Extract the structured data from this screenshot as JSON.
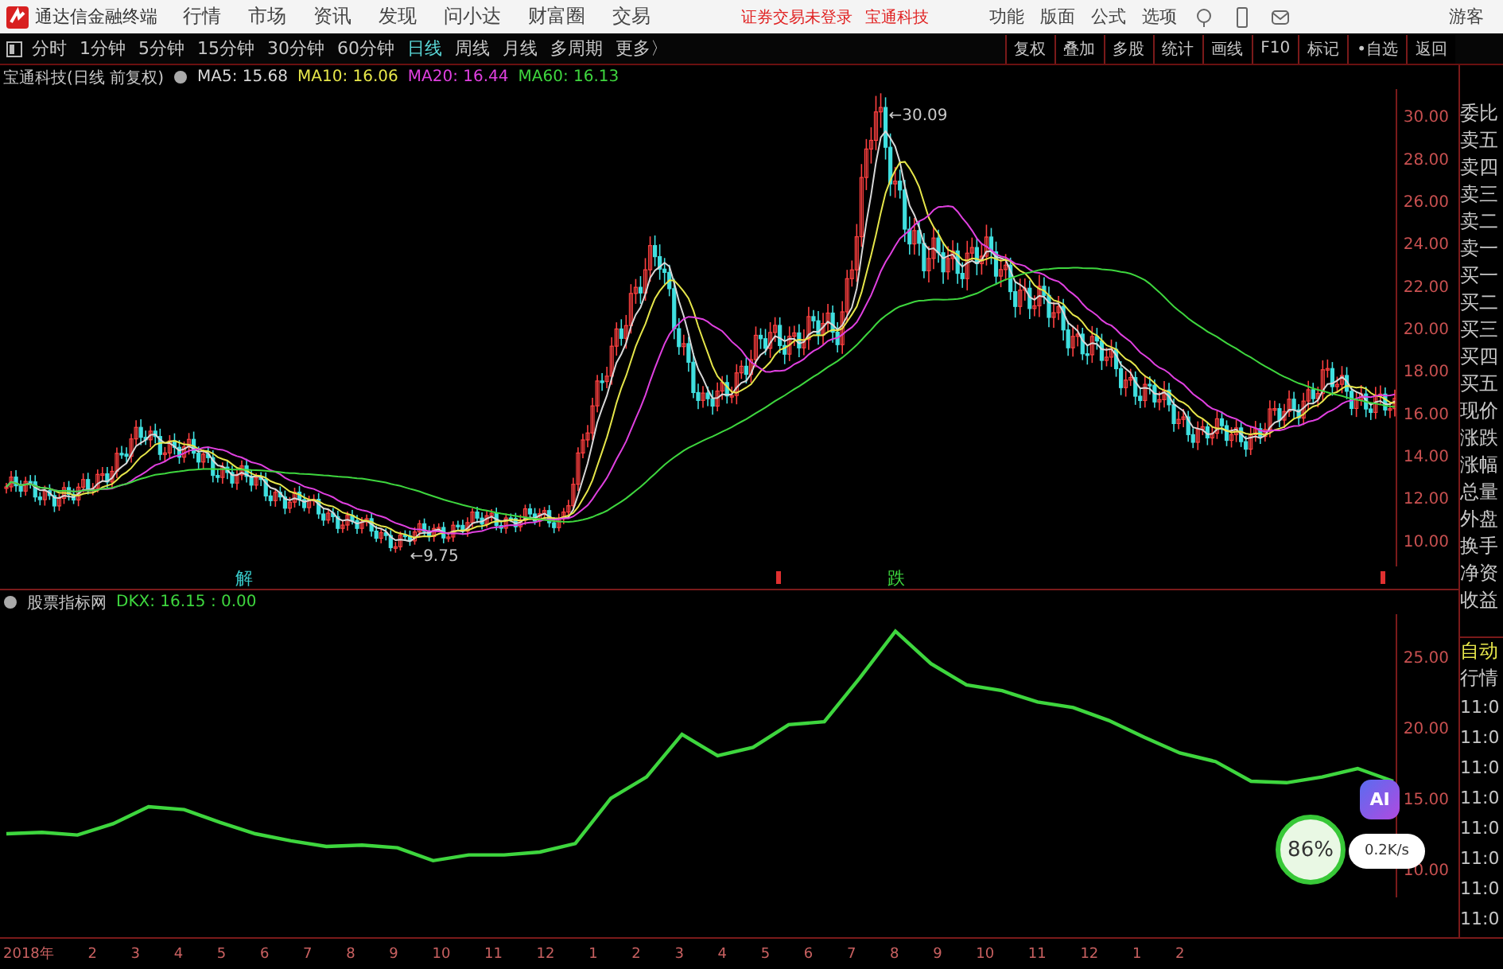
{
  "top_bar": {
    "app_title": "通达信金融终端",
    "menu": [
      "行情",
      "市场",
      "资讯",
      "发现",
      "问小达",
      "财富圈",
      "交易"
    ],
    "notices": [
      "证券交易未登录",
      "宝通科技"
    ],
    "right_menu": [
      "功能",
      "版面",
      "公式",
      "选项"
    ],
    "user": "游客"
  },
  "period_tabs": [
    {
      "label": "分时",
      "selected": false
    },
    {
      "label": "1分钟",
      "selected": false
    },
    {
      "label": "5分钟",
      "selected": false
    },
    {
      "label": "15分钟",
      "selected": false
    },
    {
      "label": "30分钟",
      "selected": false
    },
    {
      "label": "60分钟",
      "selected": false
    },
    {
      "label": "日线",
      "selected": true
    },
    {
      "label": "周线",
      "selected": false
    },
    {
      "label": "月线",
      "selected": false
    },
    {
      "label": "多周期",
      "selected": false
    },
    {
      "label": "更多〉",
      "selected": false
    }
  ],
  "tool_buttons": [
    "复权",
    "叠加",
    "多股",
    "统计",
    "画线",
    "F10",
    "标记",
    "•自选",
    "返回"
  ],
  "main_chart": {
    "title": "宝通科技(日线 前复权)",
    "ma": [
      {
        "label": "MA5: 15.68",
        "color": "#d8d8d8"
      },
      {
        "label": "MA10: 16.06",
        "color": "#e6e64a"
      },
      {
        "label": "MA20: 16.44",
        "color": "#e040e0"
      },
      {
        "label": "MA60: 16.13",
        "color": "#3ed63e"
      }
    ],
    "price_labels": [
      "30.00",
      "28.00",
      "26.00",
      "24.00",
      "22.00",
      "20.00",
      "18.00",
      "16.00",
      "14.00",
      "12.00",
      "10.00"
    ],
    "high_label": "←30.09",
    "low_label": "←9.75",
    "signals": [
      {
        "text": "解",
        "color": "#38c8c8"
      },
      {
        "text": "跌",
        "color": "#3ed63e"
      }
    ]
  },
  "indicator": {
    "title": "股票指标网",
    "reading": ": 16.15 : 0.00",
    "chart_data": {
      "type": "line",
      "series": [
        {
          "name": "DKX",
          "color": "#3ed63e",
          "values": [
            12.5,
            12.6,
            12.4,
            13.2,
            14.4,
            14.2,
            13.3,
            12.5,
            12,
            11.6,
            11.7,
            11.5,
            10.6,
            11,
            11,
            11.2,
            11.8,
            15,
            16.5,
            19.5,
            18,
            18.6,
            20.2,
            20.4,
            23.5,
            26.8,
            24.5,
            23,
            22.6,
            21.8,
            21.4,
            20.5,
            19.3,
            18.2,
            17.6,
            16.2,
            16.1,
            16.5,
            17.1,
            16.2
          ]
        }
      ],
      "ylim": [
        8,
        28
      ],
      "yticks": [
        {
          "value": 25,
          "label": "25.00"
        },
        {
          "value": 20,
          "label": "20.00"
        },
        {
          "value": 15,
          "label": "15.00"
        },
        {
          "value": 10,
          "label": "10.00"
        }
      ]
    }
  },
  "side_panel": {
    "quote_labels": [
      "委比",
      "卖五",
      "卖四",
      "卖三",
      "卖二",
      "卖一",
      "买一",
      "买二",
      "买三",
      "买四",
      "买五",
      "现价",
      "涨跌",
      "涨幅",
      "总量",
      "外盘",
      "换手",
      "净资",
      "收益"
    ],
    "trade_labels": [
      "自动",
      "行情"
    ],
    "times": [
      "11:0",
      "11:0",
      "11:0",
      "11:0",
      "11:0",
      "11:0",
      "11:0",
      "11:0"
    ]
  },
  "time_axis": [
    "2018年",
    "2",
    "3",
    "4",
    "5",
    "6",
    "7",
    "8",
    "9",
    "10",
    "11",
    "12",
    "1",
    "2",
    "3",
    "4",
    "5",
    "6",
    "7",
    "8",
    "9",
    "10",
    "11",
    "12",
    "1",
    "2"
  ],
  "overlay": {
    "ai_button": "AI",
    "load": "86%",
    "speed": "0.2K/s"
  }
}
